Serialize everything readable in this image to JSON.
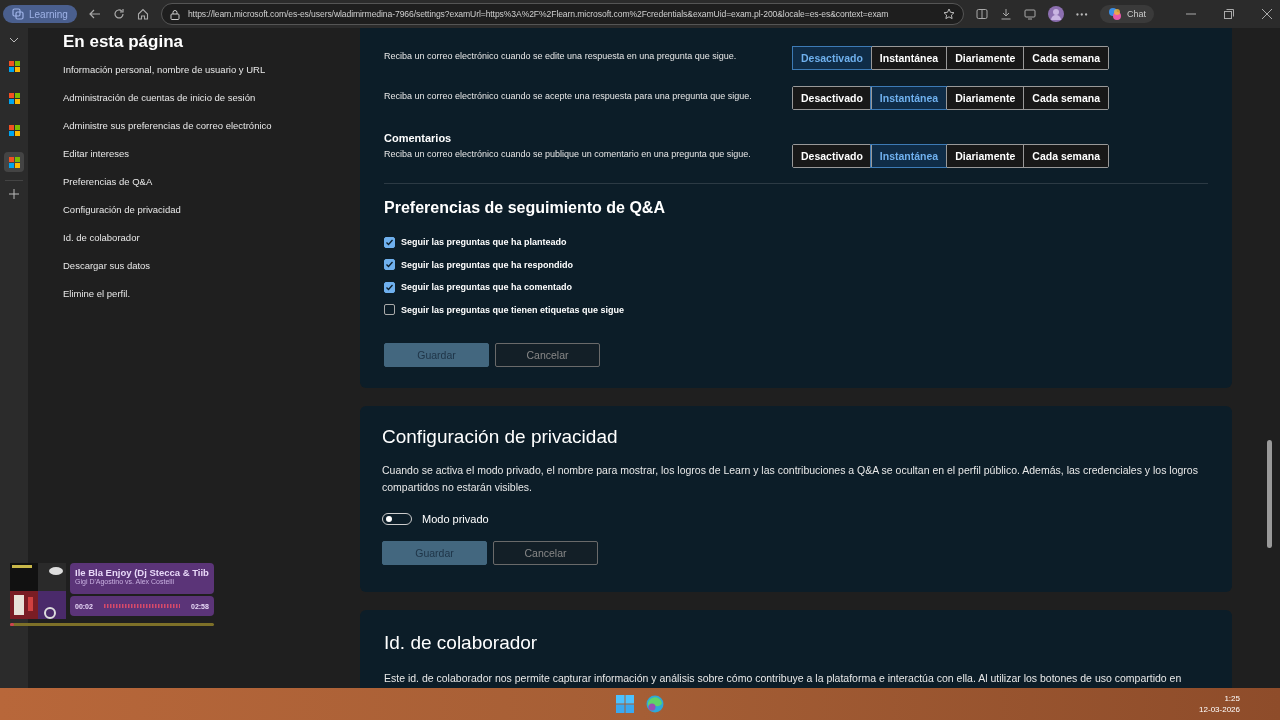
{
  "browser": {
    "tab_label": "Learning",
    "url": "https://learn.microsoft.com/es-es/users/wladimirmedina-7966/settings?examUrl=https%3A%2F%2Flearn.microsoft.com%2Fcredentials&examUid=exam.pl-200&locale=es-es&context=exam",
    "chat_label": "Chat"
  },
  "vertical_tabs": [
    {
      "selected": false
    },
    {
      "selected": false
    },
    {
      "selected": false
    },
    {
      "selected": true
    }
  ],
  "sidebar": {
    "title": "En esta página",
    "items": [
      "Información personal, nombre de usuario y URL",
      "Administración de cuentas de inicio de sesión",
      "Administre sus preferencias de correo electrónico",
      "Editar intereses",
      "Preferencias de Q&A",
      "Configuración de privacidad",
      "Id. de colaborador",
      "Descargar sus datos",
      "Elimine el perfil."
    ]
  },
  "notification_rows": [
    {
      "description": "Reciba un correo electrónico cuando se edite una respuesta en una pregunta que sigue.",
      "options": [
        {
          "label": "Desactivado",
          "selected": true
        },
        {
          "label": "Instantánea",
          "selected": false
        },
        {
          "label": "Diariamente",
          "selected": false
        },
        {
          "label": "Cada semana",
          "selected": false
        }
      ]
    },
    {
      "description": "Reciba un correo electrónico cuando se acepte una respuesta para una pregunta que sigue.",
      "options": [
        {
          "label": "Desactivado",
          "selected": false
        },
        {
          "label": "Instantánea",
          "selected": true
        },
        {
          "label": "Diariamente",
          "selected": false
        },
        {
          "label": "Cada semana",
          "selected": false
        }
      ]
    },
    {
      "heading": "Comentarios",
      "description": "Reciba un correo electrónico cuando se publique un comentario en una pregunta que sigue.",
      "options": [
        {
          "label": "Desactivado",
          "selected": false
        },
        {
          "label": "Instantánea",
          "selected": true
        },
        {
          "label": "Diariamente",
          "selected": false
        },
        {
          "label": "Cada semana",
          "selected": false
        }
      ]
    }
  ],
  "follow_preferences": {
    "title": "Preferencias de seguimiento de Q&A",
    "checkboxes": [
      {
        "label": "Seguir las preguntas que ha planteado",
        "checked": true
      },
      {
        "label": "Seguir las preguntas que ha respondido",
        "checked": true
      },
      {
        "label": "Seguir las preguntas que ha comentado",
        "checked": true
      },
      {
        "label": "Seguir las preguntas que tienen etiquetas que sigue",
        "checked": false
      }
    ],
    "buttons": [
      {
        "label": "Guardar",
        "kind": "primary",
        "disabled": true
      },
      {
        "label": "Cancelar",
        "kind": "secondary",
        "disabled": true
      }
    ]
  },
  "privacy": {
    "title": "Configuración de privacidad",
    "text": "Cuando se activa el modo privado, el nombre para mostrar, los logros de Learn y las contribuciones a Q&A se ocultan en el perfil público. Además, las credenciales y los logros compartidos no estarán visibles.",
    "toggle": {
      "label": "Modo privado",
      "on": false
    },
    "buttons": [
      {
        "label": "Guardar",
        "kind": "primary",
        "disabled": true
      },
      {
        "label": "Cancelar",
        "kind": "secondary",
        "disabled": true
      }
    ]
  },
  "contributor": {
    "title": "Id. de colaborador",
    "text": "Este id. de colaborador nos permite capturar información y análisis sobre cómo contribuye a la plataforma e interactúa con ella. Al utilizar los botones de uso compartido en"
  },
  "media_player": {
    "title": "Ile Bla Enjoy (Dj Stecca & Tiib",
    "artist": "Gigi D'Agostino vs. Alex Costelli",
    "elapsed": "00:02",
    "duration": "02:58",
    "level": 0.02
  },
  "taskbar": {
    "time": "1:25",
    "date": "12-03-2026"
  }
}
